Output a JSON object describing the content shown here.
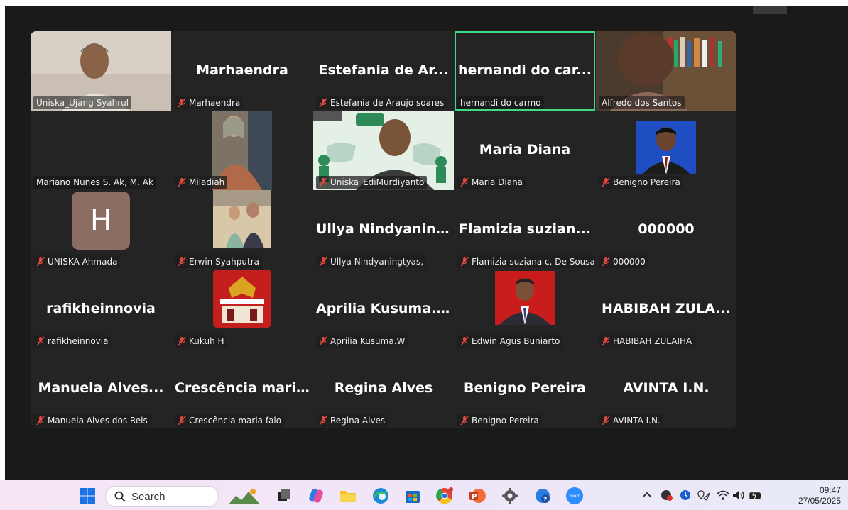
{
  "tiles": [
    {
      "label": "Uniska_Ujang Syahrul",
      "big": ""
    },
    {
      "label": "Marhaendra",
      "big": "Marhaendra"
    },
    {
      "label": "Estefania de Araujo soares",
      "big": "Estefania de Ar..."
    },
    {
      "label": "hernandi do carmo",
      "big": "hernandi do car..."
    },
    {
      "label": "Alfredo dos Santos",
      "big": ""
    },
    {
      "label": "Mariano Nunes S. Ak, M. Ak",
      "big": ""
    },
    {
      "label": "Miladiah",
      "big": ""
    },
    {
      "label": "Uniska_EdiMurdiyanto",
      "big": ""
    },
    {
      "label": "Maria Diana",
      "big": "Maria Diana"
    },
    {
      "label": "Benigno Pereira",
      "big": ""
    },
    {
      "label": "UNISKA Ahmada",
      "big": "",
      "avatar_letter": "H"
    },
    {
      "label": "Erwin Syahputra",
      "big": ""
    },
    {
      "label": "Ullya Nindyaningtyas,",
      "big": "Ullya Nindyanin..."
    },
    {
      "label": "Flamizia suziana c. De Sousa",
      "big": "Flamizia suzian..."
    },
    {
      "label": "000000",
      "big": "000000"
    },
    {
      "label": "rafikheinnovia",
      "big": "rafikheinnovia"
    },
    {
      "label": "Kukuh H",
      "big": ""
    },
    {
      "label": "Aprilia Kusuma.W",
      "big": "Aprilia Kusuma...."
    },
    {
      "label": "Edwin Agus Buniarto",
      "big": ""
    },
    {
      "label": "HABIBAH ZULAIHA",
      "big": "HABIBAH ZULA..."
    },
    {
      "label": "Manuela Alves dos Reis",
      "big": "Manuela Alves..."
    },
    {
      "label": "Crescência maria falo",
      "big": "Crescência mari..."
    },
    {
      "label": "Regina Alves",
      "big": "Regina Alves"
    },
    {
      "label": "Benigno Pereira",
      "big": "Benigno Pereira"
    },
    {
      "label": "AVINTA I.N.",
      "big": "AVINTA I.N."
    }
  ],
  "taskbar": {
    "search_label": "Search",
    "time": "09:47",
    "date": "27/05/2025",
    "zoom_label": "zoom"
  },
  "colors": {
    "speaking": "#3ddc84",
    "muted": "#e0483e",
    "avatar": "#8b6e61"
  }
}
